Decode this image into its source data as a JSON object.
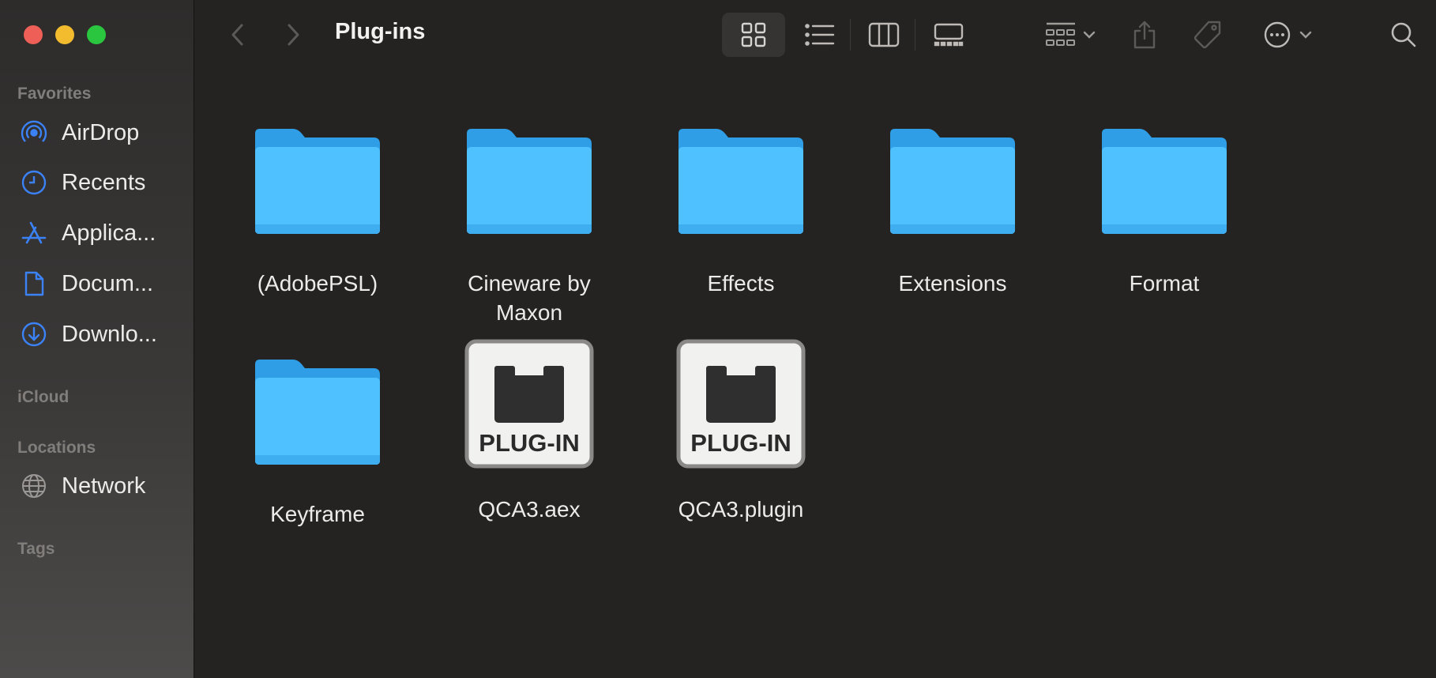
{
  "window": {
    "title": "Plug-ins"
  },
  "sidebar": {
    "favorites_heading": "Favorites",
    "favorites": [
      {
        "label": "AirDrop",
        "icon": "airdrop-icon"
      },
      {
        "label": "Recents",
        "icon": "clock-icon"
      },
      {
        "label": "Applica...",
        "icon": "applications-icon"
      },
      {
        "label": "Docum...",
        "icon": "document-icon"
      },
      {
        "label": "Downlo...",
        "icon": "download-icon"
      }
    ],
    "icloud_heading": "iCloud",
    "locations_heading": "Locations",
    "locations": [
      {
        "label": "Network",
        "icon": "globe-icon"
      }
    ],
    "tags_heading": "Tags"
  },
  "toolbar": {
    "accent": "#3a82f6",
    "icons": [
      "back-icon",
      "forward-icon",
      "icon-view-icon",
      "list-view-icon",
      "column-view-icon",
      "gallery-view-icon",
      "group-icon",
      "share-icon",
      "tag-icon",
      "more-icon",
      "search-icon"
    ]
  },
  "items": [
    {
      "name": "(AdobePSL)",
      "type": "folder"
    },
    {
      "name": "Cineware by Maxon",
      "type": "folder"
    },
    {
      "name": "Effects",
      "type": "folder"
    },
    {
      "name": "Extensions",
      "type": "folder"
    },
    {
      "name": "Format",
      "type": "folder"
    },
    {
      "name": "Keyframe",
      "type": "folder"
    },
    {
      "name": "QCA3.aex",
      "type": "plugin"
    },
    {
      "name": "QCA3.plugin",
      "type": "plugin"
    }
  ],
  "plugin_badge": "PLUG-IN",
  "colors": {
    "folder": "#4fc1ff",
    "folder_tab": "#2f9ee6",
    "background": "#252321"
  }
}
